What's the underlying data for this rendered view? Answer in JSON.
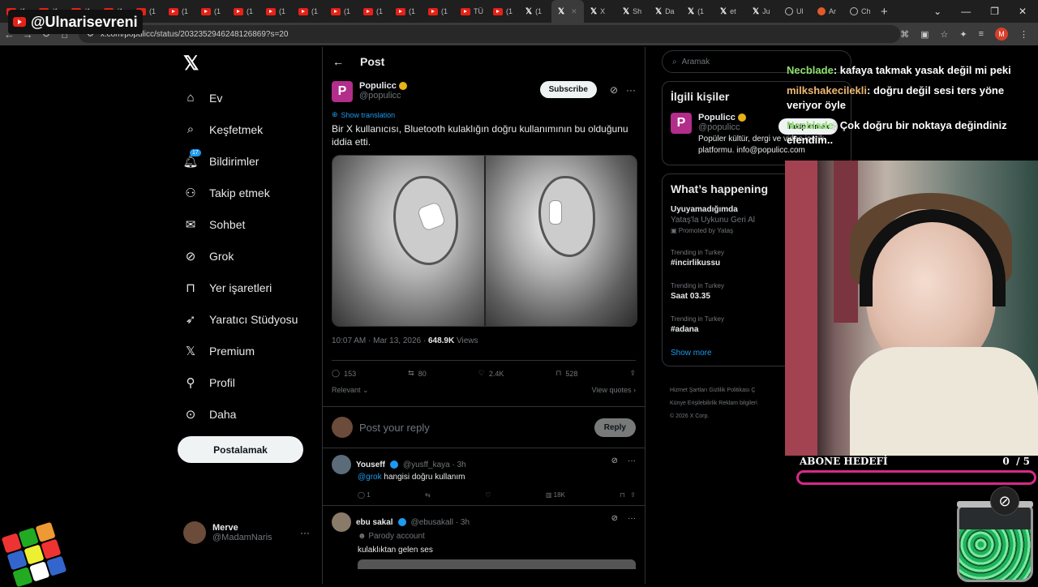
{
  "browser": {
    "tabs": [
      {
        "label": "(1",
        "icon": "youtube-icon"
      },
      {
        "label": "(1",
        "icon": "youtube-icon"
      },
      {
        "label": "(1",
        "icon": "youtube-icon"
      },
      {
        "label": "(1",
        "icon": "youtube-icon"
      },
      {
        "label": "(1",
        "icon": "youtube-icon"
      },
      {
        "label": "(1",
        "icon": "youtube-icon"
      },
      {
        "label": "(1",
        "icon": "youtube-icon"
      },
      {
        "label": "(1",
        "icon": "youtube-icon"
      },
      {
        "label": "(1",
        "icon": "youtube-icon"
      },
      {
        "label": "(1",
        "icon": "youtube-icon"
      },
      {
        "label": "(1",
        "icon": "youtube-icon"
      },
      {
        "label": "(1",
        "icon": "youtube-icon"
      },
      {
        "label": "(1",
        "icon": "youtube-icon"
      },
      {
        "label": "(1",
        "icon": "youtube-icon"
      },
      {
        "label": "TÜ",
        "icon": "youtube-icon"
      },
      {
        "label": "(1",
        "icon": "youtube-icon"
      },
      {
        "label": "(1",
        "icon": "x-icon"
      },
      {
        "label": "",
        "icon": "x-icon",
        "active": true
      },
      {
        "label": "X",
        "icon": "x-icon"
      },
      {
        "label": "Sh",
        "icon": "x-icon"
      },
      {
        "label": "Da",
        "icon": "x-icon"
      },
      {
        "label": "(1",
        "icon": "x-icon"
      },
      {
        "label": "et",
        "icon": "x-icon"
      },
      {
        "label": "Ju",
        "icon": "x-icon"
      },
      {
        "label": "Ul",
        "icon": "history-icon"
      },
      {
        "label": "Ar",
        "icon": "reddit-icon"
      },
      {
        "label": "Ch",
        "icon": "globe-icon"
      }
    ],
    "url": "x.com/populicc/status/2032352946248126869?s=20",
    "profile_letter": "M"
  },
  "streamer_name": "@Ulnarisevreni",
  "left_nav": {
    "items": [
      {
        "label": "Ev",
        "icon": "home-icon"
      },
      {
        "label": "Keşfetmek",
        "icon": "search-icon"
      },
      {
        "label": "Bildirimler",
        "icon": "bell-icon",
        "badge": "17"
      },
      {
        "label": "Takip etmek",
        "icon": "add-user-icon"
      },
      {
        "label": "Sohbet",
        "icon": "mail-icon"
      },
      {
        "label": "Grok",
        "icon": "grok-icon"
      },
      {
        "label": "Yer işaretleri",
        "icon": "bookmark-icon"
      },
      {
        "label": "Yaratıcı Stüdyosu",
        "icon": "rocket-icon"
      },
      {
        "label": "Premium",
        "icon": "x-icon"
      },
      {
        "label": "Profil",
        "icon": "user-icon"
      },
      {
        "label": "Daha",
        "icon": "more-circle-icon"
      }
    ],
    "post_button": "Postalamak",
    "account_name": "Merve",
    "account_handle": "@MadamNaris"
  },
  "post": {
    "header": "Post",
    "author": "Populicc",
    "handle": "@populicc",
    "subscribe": "Subscribe",
    "show_translation": "Show translation",
    "text": "Bir X kullanıcısı, Bluetooth kulaklığın doğru kullanımının bu olduğunu iddia etti.",
    "time": "10:07 AM · Mar 13, 2026 · ",
    "views": "648.9K",
    "views_label": " Views",
    "replies": "153",
    "reposts": "80",
    "likes": "2.4K",
    "bookmarks": "528",
    "relevant": "Relevant",
    "view_quotes": "View quotes",
    "reply_placeholder": "Post your reply",
    "reply_button": "Reply"
  },
  "replies": [
    {
      "name": "Youseff",
      "handle": "@yusff_kaya · 3h",
      "mention": "@grok",
      "text": " hangisi doğru kullanım",
      "reply_count": "1",
      "views": "18K"
    },
    {
      "name": "ebu sakal",
      "handle": "@ebusakall · 3h",
      "parody": "Parody account",
      "text": "kulaklıktan gelen ses"
    }
  ],
  "right": {
    "search_placeholder": "Aramak",
    "related_title": "İlgili kişiler",
    "related_name": "Populicc",
    "related_handle": "@populicc",
    "follow": "Takip etmek",
    "bio": "Popüler kültür, dergi ve video içerik platformu. info@populicc.com",
    "happening_title": "What’s happening",
    "trends": [
      {
        "cat": "",
        "title": "Uyuyamadığımda",
        "sub": "Yataş'la Uykunu Geri Al",
        "extra": "Promoted by Yataş"
      },
      {
        "cat": "Trending in Turkey",
        "title": "#incirlikussu",
        "sub": ""
      },
      {
        "cat": "Trending in Turkey",
        "title": "Saat 03.35",
        "sub": ""
      },
      {
        "cat": "Trending in Turkey",
        "title": "#adana",
        "sub": ""
      }
    ],
    "show_more": "Show more",
    "footer1": "Hizmet Şartları    Gizlilik Politikası    Ç",
    "footer2": "Künye    Erişilebilirlik    Reklam bilgileri",
    "footer3": "© 2026 X Corp."
  },
  "chat": [
    {
      "user": "Necblade",
      "msg": ": kafaya takmak yasak değil mi peki"
    },
    {
      "user": "milkshakecilekli",
      "msg": ": doğru değil sesi ters yöne veriyor öyle"
    },
    {
      "user": "Necblade",
      "msg": ": Çok doğru bir noktaya değindiniz efendim.."
    }
  ],
  "sub_goal": {
    "label": "ABONE HEDEFİ",
    "current": "0",
    "target": "/ 5",
    "progress": 0
  },
  "colors": {
    "accent": "#1d9bf0",
    "populicc": "#b32d8b",
    "chat_green": "#8ee06a",
    "chat_orange": "#f0b872",
    "goal_pink": "#d62a86"
  }
}
